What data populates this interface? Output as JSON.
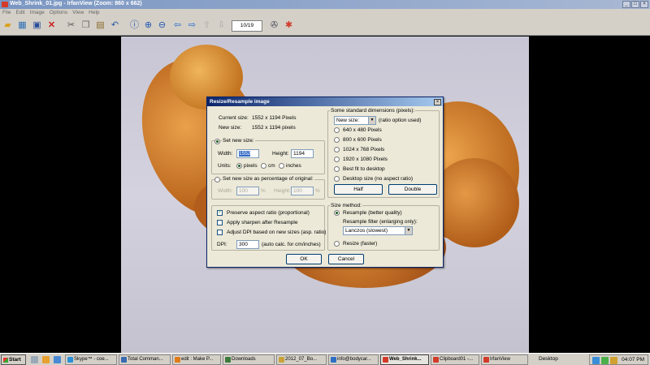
{
  "window": {
    "title": "Web_Shrink_01.jpg - IrfanView (Zoom: 860 x 662)"
  },
  "menu": [
    "File",
    "Edit",
    "Image",
    "Options",
    "View",
    "Help"
  ],
  "toolbar": {
    "icons": [
      "open-folder-icon",
      "thumbnails-icon",
      "save-icon",
      "delete-icon",
      "cut-icon",
      "copy-icon",
      "paste-icon",
      "undo-icon",
      "info-icon",
      "zoom-in-icon",
      "zoom-out-icon",
      "previous-icon",
      "next-icon",
      "page-up-icon",
      "page-down-icon",
      "settings-icon",
      "irfanview-logo-icon"
    ],
    "page_counter": "10/19"
  },
  "dialog": {
    "title": "Resize/Resample image",
    "current_size_label": "Current size:",
    "current_size_value": "1552  x  1194  Pixels",
    "new_size_label": "New size:",
    "new_size_value": "1552  x  1194  pixels",
    "set_new_size": {
      "label": "Set new size:",
      "width_label": "Width:",
      "width_value": "1552",
      "height_label": "Height:",
      "height_value": "1194",
      "units_label": "Units:",
      "units": [
        "pixels",
        "cm",
        "inches"
      ],
      "selected_unit": "pixels"
    },
    "percentage": {
      "label": "Set new size as percentage of original:",
      "width_label": "Width:",
      "width_value": "100",
      "height_label": "Height:",
      "height_value": "100",
      "unit": "%"
    },
    "options": {
      "preserve_aspect": {
        "label": "Preserve aspect ratio (proportional)",
        "checked": true
      },
      "apply_sharpen": {
        "label": "Apply sharpen after Resample",
        "checked": false
      },
      "adjust_dpi": {
        "label": "Adjust DPI based on new sizes (asp. ratio)",
        "checked": false
      },
      "dpi_label": "DPI:",
      "dpi_value": "300",
      "dpi_note": "(auto calc. for cm/inches)"
    },
    "standard_dims": {
      "label": "Some standard dimensions (pixels):",
      "combo_value": "New size:",
      "combo_note": "(ratio option used)",
      "items": [
        "640 x 480 Pixels",
        "800 x 600 Pixels",
        "1024 x 768 Pixels",
        "1920 x 1080 Pixels",
        "Best fit to desktop",
        "Desktop size (no aspect ratio)"
      ],
      "half_label": "Half",
      "double_label": "Double"
    },
    "size_method": {
      "label": "Size method:",
      "resample_label": "Resample (better quality)",
      "filter_label": "Resample filter (enlarging only):",
      "filter_value": "Lanczos (slowest)",
      "resize_label": "Resize (faster)",
      "selected": "resample"
    },
    "ok_label": "OK",
    "cancel_label": "Cancel"
  },
  "taskbar": {
    "start_label": "Start",
    "tasks": [
      {
        "label": "Skype™ - coe...",
        "color": "#2a8fd6"
      },
      {
        "label": "Total Comman...",
        "color": "#3a6ab0"
      },
      {
        "label": "edit : Make P...",
        "color": "#e07b1a"
      },
      {
        "label": "Downloads",
        "color": "#3b7a3b"
      },
      {
        "label": "2012_07_Bo...",
        "color": "#c9a23a"
      },
      {
        "label": "info@bodycar...",
        "color": "#2e6fc4"
      },
      {
        "label": "Web_Shrink...",
        "color": "#d23a2a"
      },
      {
        "label": "Clipboard01 -...",
        "color": "#d23a2a"
      },
      {
        "label": "IrfanView",
        "color": "#d23a2a"
      }
    ],
    "active_task": 6,
    "desktop_label": "Desktop",
    "clock": "04:07 PM"
  }
}
